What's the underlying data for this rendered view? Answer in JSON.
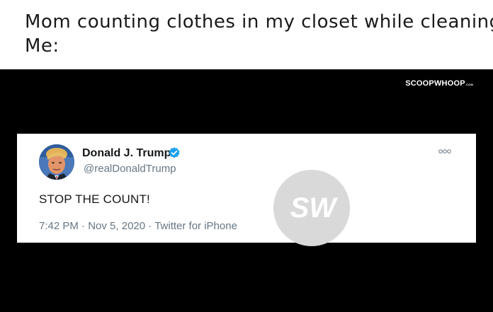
{
  "caption": {
    "line1": "Mom counting clothes in my closet while cleaning",
    "line2": "Me:"
  },
  "brand": {
    "name": "SCOOPWHOOP",
    "suffix": ".COM"
  },
  "tweet": {
    "display_name": "Donald J. Trump",
    "handle": "@realDonaldTrump",
    "text": "STOP THE COUNT!",
    "time": "7:42 PM",
    "date": "Nov 5, 2020",
    "source": "Twitter for iPhone",
    "separator": "·"
  },
  "watermark": {
    "text": "SW"
  },
  "icons": {
    "verified": "verified-badge-icon",
    "more": "more-options-icon"
  },
  "colors": {
    "background": "#000000",
    "verified": "#1da1f2",
    "secondary_text": "#657786",
    "primary_text": "#14171a",
    "watermark": "#d9d9d9"
  }
}
